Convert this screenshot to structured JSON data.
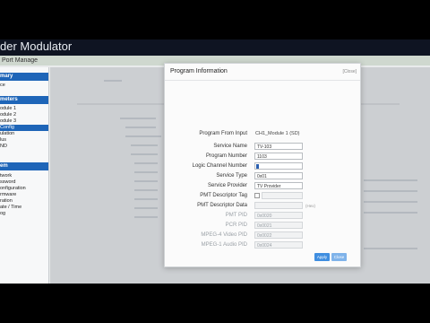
{
  "app": {
    "title": "der Modulator"
  },
  "menubar": {
    "label": "Port Manage"
  },
  "sidebar": {
    "sections": [
      {
        "label": "mary",
        "items": [
          {
            "label": "ce"
          }
        ]
      },
      {
        "label": "meters",
        "items": [
          {
            "label": "odule 1"
          },
          {
            "label": "odule 2"
          },
          {
            "label": "odule 3"
          },
          {
            "label": "Config"
          },
          {
            "label": "ulation"
          },
          {
            "label": "lus"
          },
          {
            "label": "ND"
          }
        ]
      },
      {
        "label": "em",
        "items": [
          {
            "label": "twork"
          },
          {
            "label": "ssword"
          },
          {
            "label": "onfiguration"
          },
          {
            "label": "rmware"
          },
          {
            "label": "ration"
          },
          {
            "label": "ate / Time"
          },
          {
            "label": "og"
          }
        ]
      }
    ]
  },
  "dialog": {
    "title": "Program Information",
    "close_label": "[Close]",
    "fields": {
      "program_from_input": {
        "label": "Program From Input",
        "value": "CH1_Module 1 (SD)"
      },
      "service_name": {
        "label": "Service Name",
        "value": "TV-103"
      },
      "program_number": {
        "label": "Program Number",
        "value": "1103"
      },
      "logic_channel_number": {
        "label": "Logic Channel Number",
        "value": ""
      },
      "service_type": {
        "label": "Service Type",
        "value": "0x01"
      },
      "service_provider": {
        "label": "Service Provider",
        "value": "TV Provider"
      },
      "pmt_descriptor_tag": {
        "label": "PMT Descriptor Tag",
        "value": ""
      },
      "pmt_descriptor_data": {
        "label": "PMT Descriptor Data",
        "value": "",
        "unit": "(Hex)"
      },
      "pmt_pid": {
        "label": "PMT PID",
        "value": "0x0020"
      },
      "pcr_pid": {
        "label": "PCR PID",
        "value": "0x0021"
      },
      "mpeg4_video_pid": {
        "label": "MPEG-4 Video PID",
        "value": "0x0022"
      },
      "mpeg1_audio_pid": {
        "label": "MPEG-1 Audio PID",
        "value": "0x0024"
      }
    },
    "buttons": {
      "ok": "Apply",
      "cancel": "Close"
    }
  },
  "colors": {
    "accent": "#1e65b8",
    "button_primary": "#3f8ee0",
    "header_bg": "#0f1422"
  }
}
